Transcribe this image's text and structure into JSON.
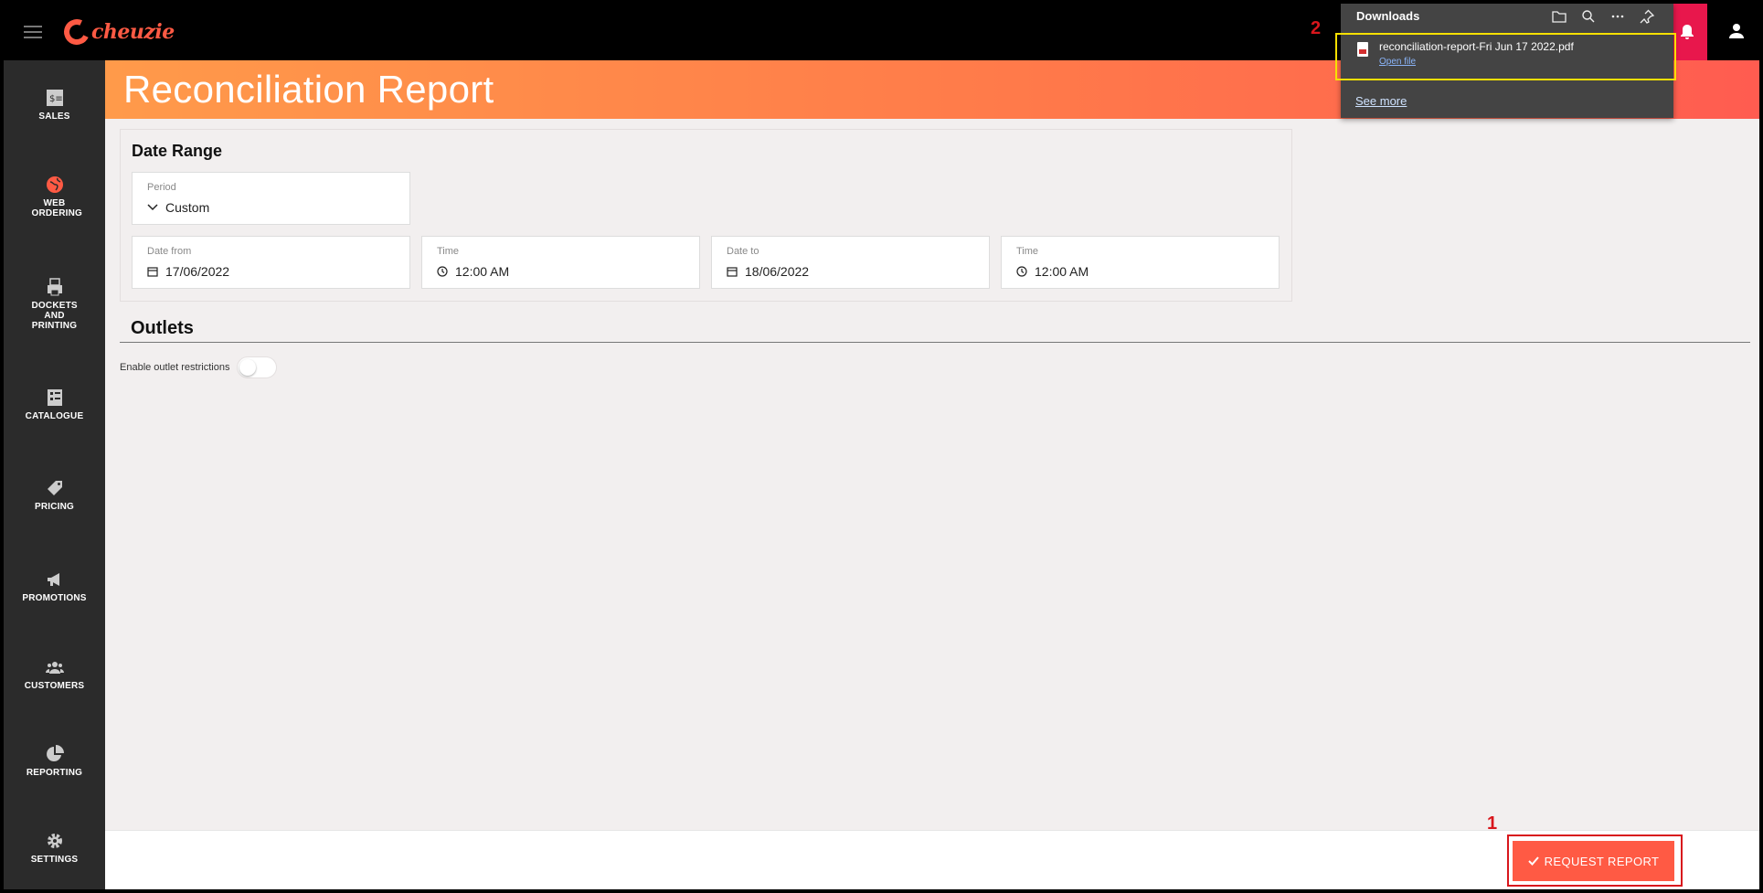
{
  "app": {
    "logo_text": "cheuzie"
  },
  "page": {
    "title": "Reconciliation Report"
  },
  "sidebar": {
    "items": [
      {
        "label": "SALES",
        "icon": "sales-icon"
      },
      {
        "label": "WEB ORDERING",
        "icon": "globe-icon"
      },
      {
        "label": "DOCKETS AND PRINTING",
        "icon": "printer-icon"
      },
      {
        "label": "CATALOGUE",
        "icon": "catalogue-icon"
      },
      {
        "label": "PRICING",
        "icon": "tag-icon"
      },
      {
        "label": "PROMOTIONS",
        "icon": "megaphone-icon"
      },
      {
        "label": "CUSTOMERS",
        "icon": "users-icon"
      },
      {
        "label": "REPORTING",
        "icon": "pie-chart-icon"
      },
      {
        "label": "SETTINGS",
        "icon": "gear-icon"
      }
    ]
  },
  "date_range": {
    "title": "Date Range",
    "period": {
      "label": "Period",
      "value": "Custom"
    },
    "date_from": {
      "label": "Date from",
      "value": "17/06/2022"
    },
    "time_from": {
      "label": "Time",
      "value": "12:00 AM"
    },
    "date_to": {
      "label": "Date to",
      "value": "18/06/2022"
    },
    "time_to": {
      "label": "Time",
      "value": "12:00 AM"
    }
  },
  "outlets": {
    "title": "Outlets",
    "toggle_label": "Enable outlet restrictions",
    "toggle_on": false
  },
  "footer": {
    "request_label": "REQUEST REPORT"
  },
  "downloads": {
    "title": "Downloads",
    "file_name": "reconciliation-report-Fri Jun 17 2022.pdf",
    "open_label": "Open file",
    "see_more": "See more"
  },
  "annotations": {
    "one": "1",
    "two": "2"
  },
  "colors": {
    "accent": "#ff5a44",
    "sidebar": "#2b2b2b",
    "notif": "#e8174c"
  }
}
